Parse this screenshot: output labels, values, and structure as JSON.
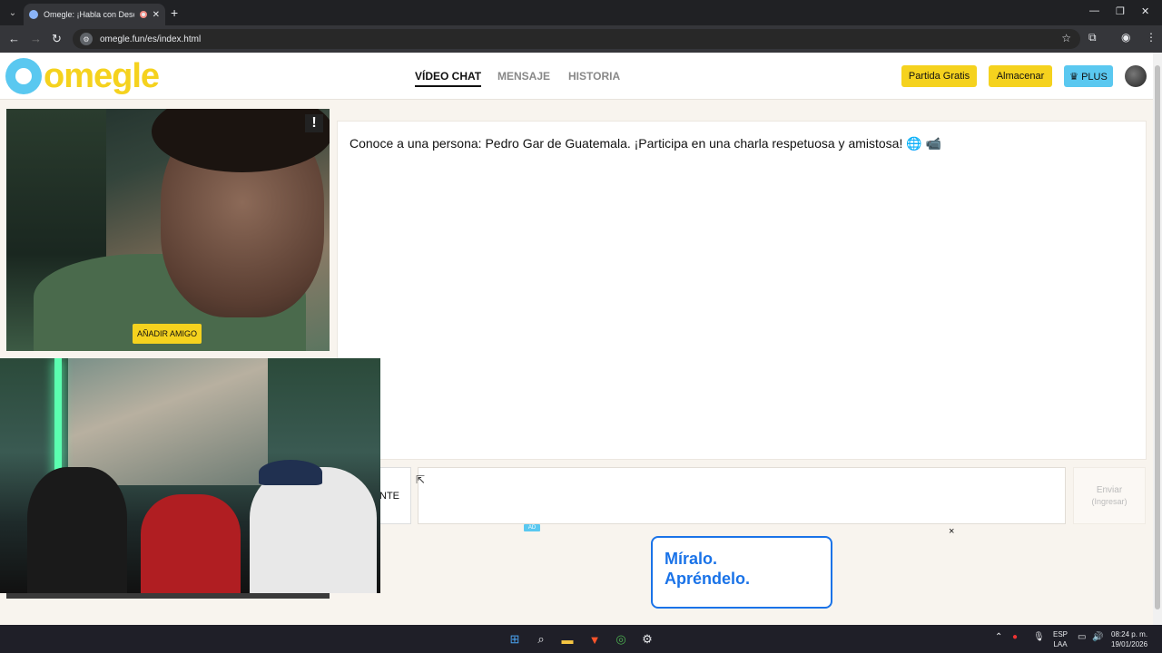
{
  "browser": {
    "tab_title": "Omegle: ¡Habla con Descon",
    "url": "omegle.fun/es/index.html"
  },
  "header": {
    "logo_text": "omegle",
    "nav": [
      {
        "label": "VÍDEO CHAT",
        "active": true
      },
      {
        "label": "MENSAJE",
        "active": false
      },
      {
        "label": "HISTORIA",
        "active": false
      }
    ],
    "buttons": {
      "free_match": "Partida Gratis",
      "store": "Almacenar",
      "plus": "♛ PLUS"
    },
    "colors": {
      "yellow": "#f5d21e",
      "blue": "#5ac8f0"
    }
  },
  "video": {
    "report_icon": "!",
    "add_friend": "AÑADIR AMIGO"
  },
  "chat": {
    "message": "Conoce a una persona: Pedro Gar de Guatemala. ¡Participa en una charla respetuosa y amistosa! 🌐 📹",
    "stop_label": "NTE",
    "input_placeholder": "",
    "send_label": "Enviar",
    "send_hint": "(Ingresar)"
  },
  "ad": {
    "tag": "AD",
    "close": "×",
    "line1": "Míralo.",
    "line2": "Apréndelo."
  },
  "taskbar": {
    "lang_line1": "ESP",
    "lang_line2": "LAA",
    "time": "08:24 p. m.",
    "date": "19/01/2026"
  }
}
